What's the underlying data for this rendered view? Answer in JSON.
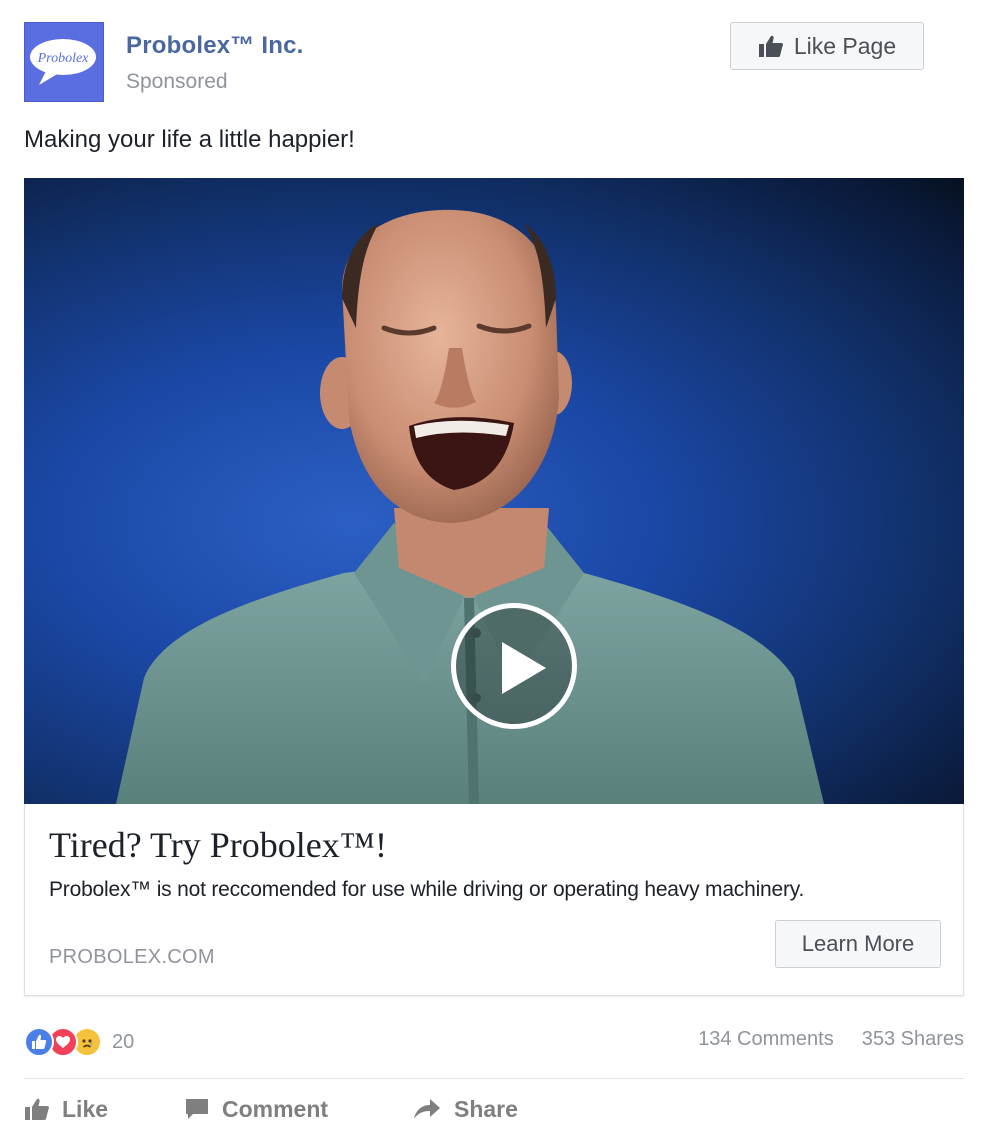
{
  "page": {
    "name": "Probolex™ Inc.",
    "sponsored_label": "Sponsored",
    "avatar_text": "Probolex",
    "like_page_label": "Like Page"
  },
  "post": {
    "caption": "Making your life a little happier!"
  },
  "link_card": {
    "headline": "Tired? Try Probolex™!",
    "description": "Probolex™ is not reccomended for use while driving or operating heavy machinery.",
    "domain": "PROBOLEX.COM",
    "cta_label": "Learn More"
  },
  "engagement": {
    "reaction_icons": [
      "like-reaction-icon",
      "love-reaction-icon",
      "sad-reaction-icon"
    ],
    "reaction_count": "20",
    "comments": "134 Comments",
    "shares": "353 Shares"
  },
  "actions": {
    "like": "Like",
    "comment": "Comment",
    "share": "Share"
  },
  "colors": {
    "brand_blue": "#4b67a1",
    "avatar_bg": "#5b6ee1",
    "muted": "#90949c",
    "like_reaction": "#4a7fe8",
    "love_reaction": "#f0405a",
    "sad_reaction": "#f5c33b"
  }
}
